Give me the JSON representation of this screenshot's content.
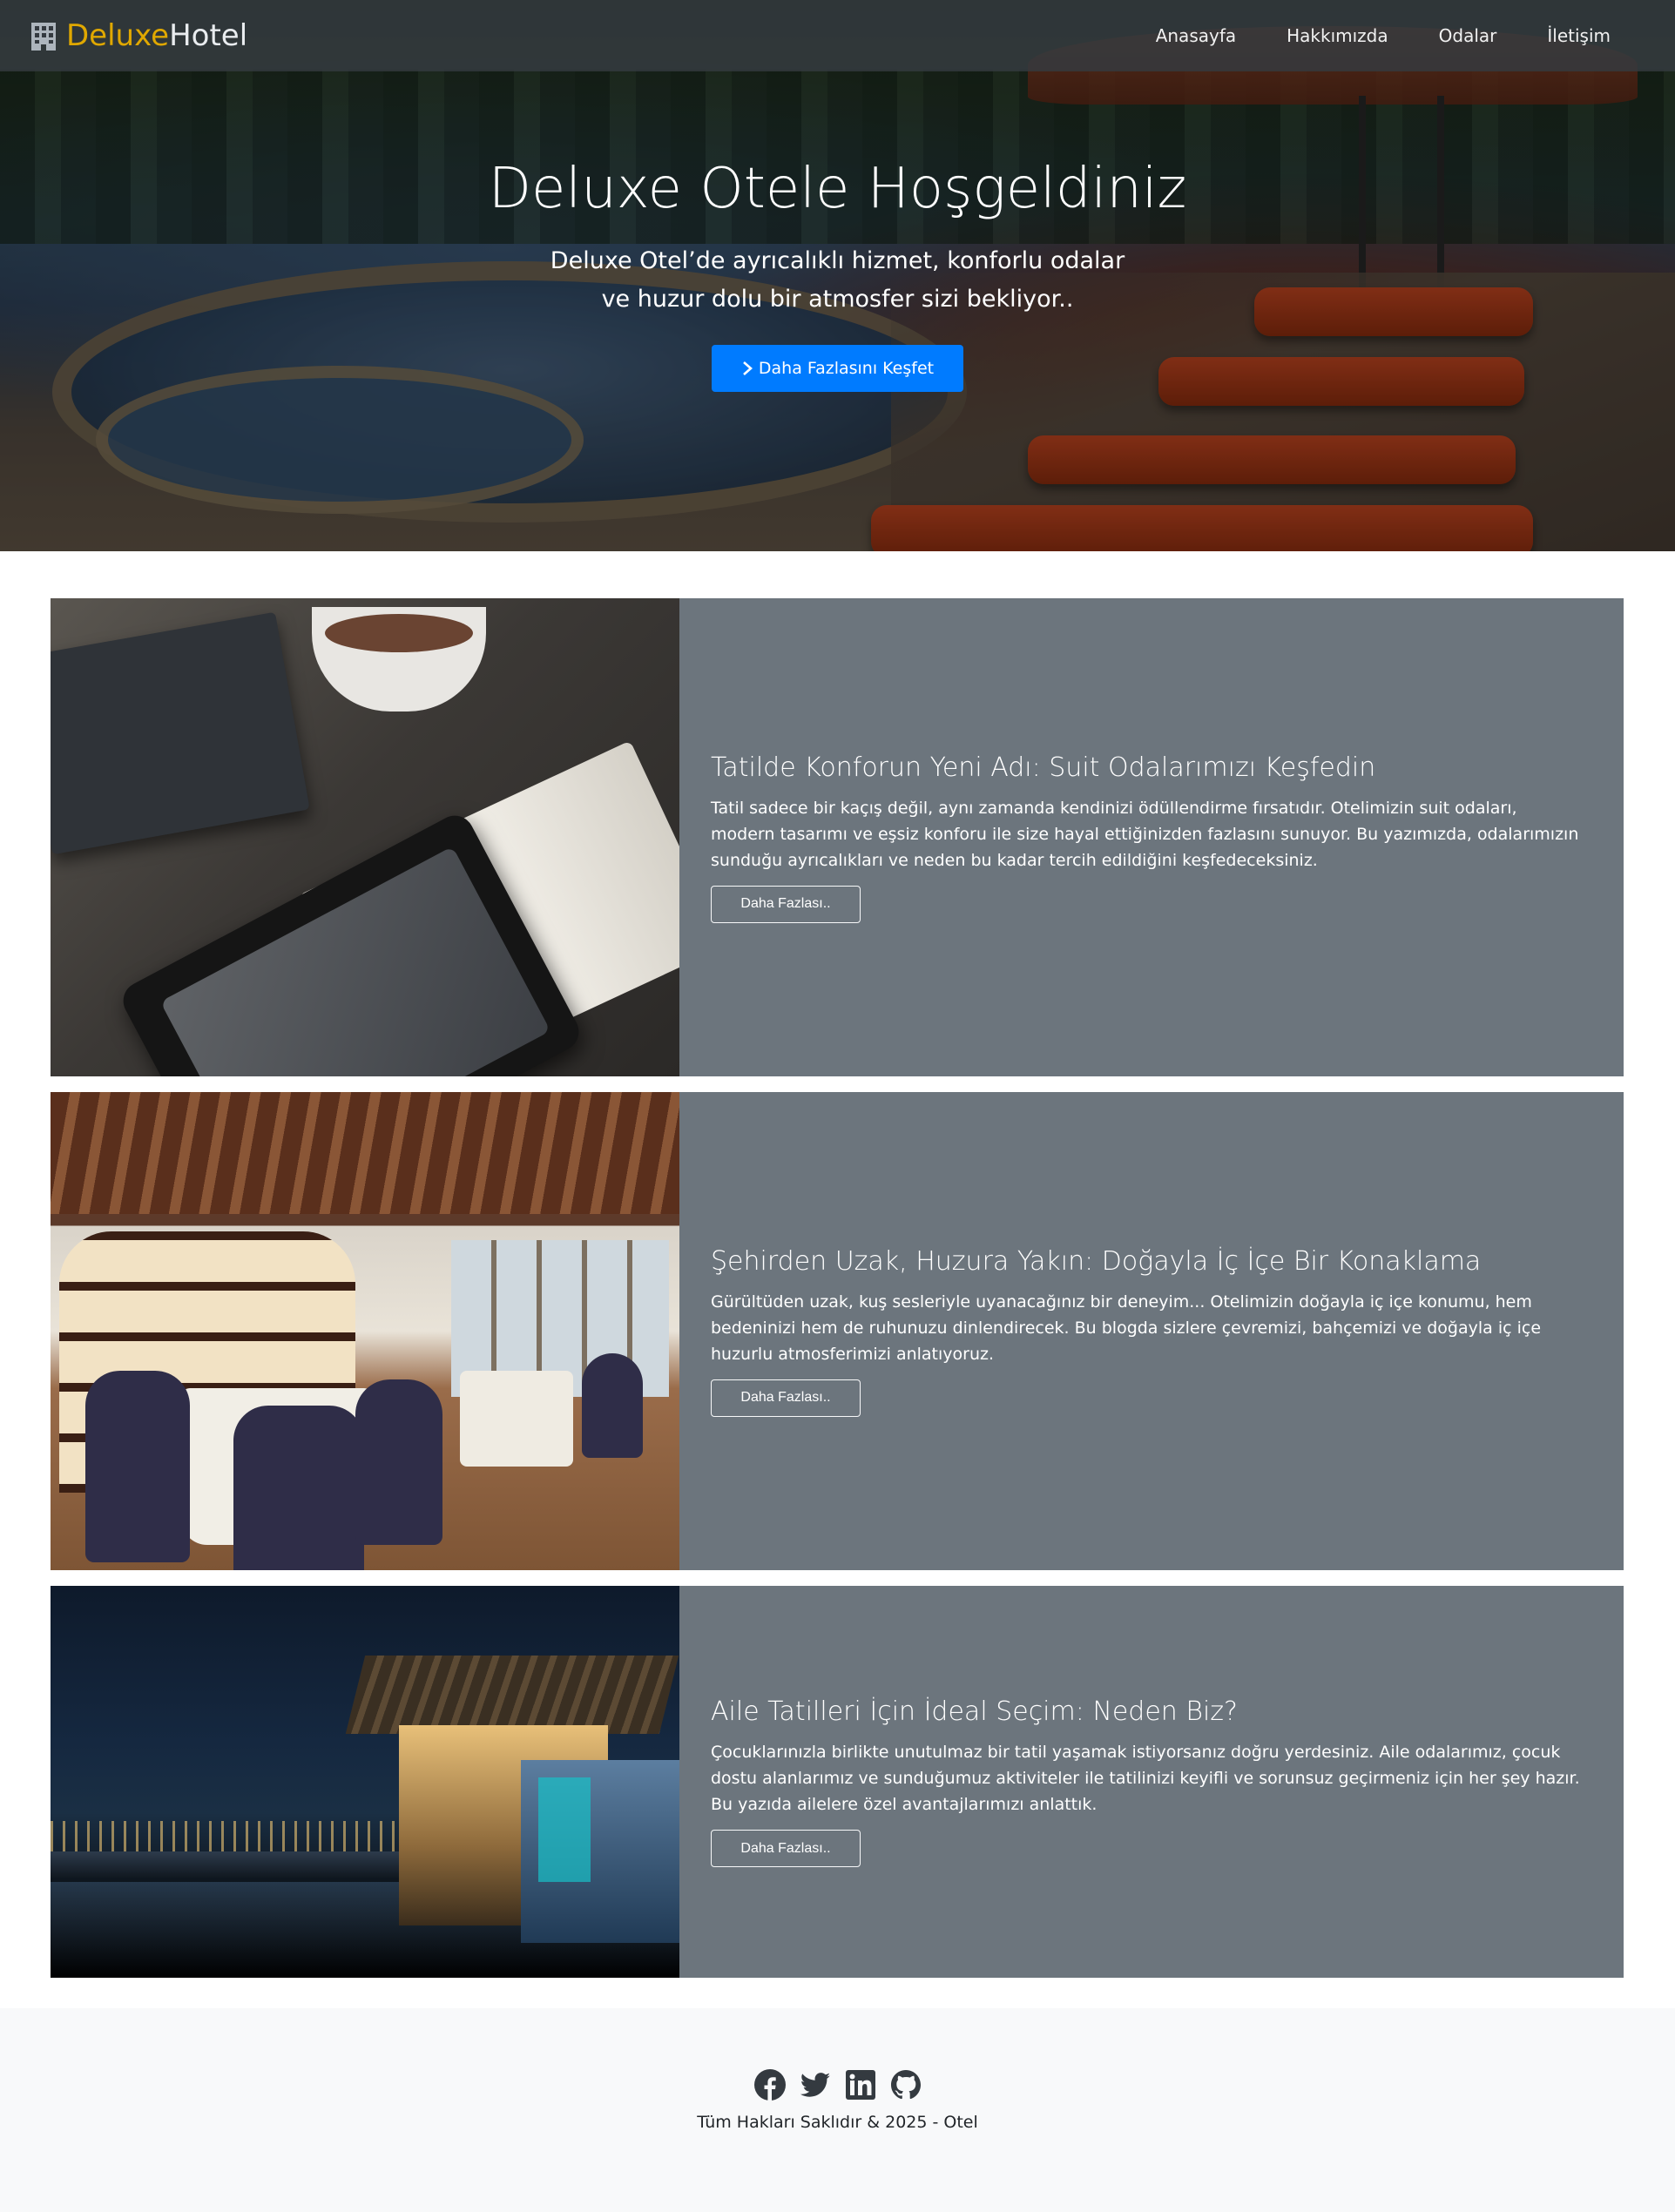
{
  "navbar": {
    "brand_part1": "Deluxe",
    "brand_part2": "Hotel",
    "brand_icon": "building-icon",
    "links": [
      "Anasayfa",
      "Hakkımızda",
      "Odalar",
      "İletişim"
    ]
  },
  "hero": {
    "title": "Deluxe Otele Hoşgeldiniz",
    "subtitle": "Deluxe Otel’de ayrıcalıklı hizmet, konforlu odalar ve huzur dolu bir atmosfer sizi bekliyor..",
    "button_label": "Daha Fazlasını Keşfet",
    "button_icon": "chevron-right-icon",
    "button_color": "#007bff"
  },
  "cards": [
    {
      "title": "Tatilde Konforun Yeni Adı: Suit Odalarımızı Keşfedin",
      "text": "Tatil sadece bir kaçış değil, aynı zamanda kendinizi ödüllendirme fırsatıdır. Otelimizin suit odaları, modern tasarımı ve eşsiz konforu ile size hayal ettiğinizden fazlasını sunuyor. Bu yazımızda, odalarımızın sunduğu ayrıcalıkları ve neden bu kadar tercih edildiğini keşfedeceksiniz.",
      "button_label": "Daha Fazlası.."
    },
    {
      "title": "Şehirden Uzak, Huzura Yakın: Doğayla İç İçe Bir Konaklama",
      "text": "Gürültüden uzak, kuş sesleriyle uyanacağınız bir deneyim... Otelimizin doğayla iç içe konumu, hem bedeninizi hem de ruhunuzu dinlendirecek. Bu blogda sizlere çevremizi, bahçemizi ve doğayla iç içe huzurlu atmosferimizi anlatıyoruz.",
      "button_label": "Daha Fazlası.."
    },
    {
      "title": "Aile Tatilleri İçin İdeal Seçim: Neden Biz?",
      "text": "Çocuklarınızla birlikte unutulmaz bir tatil yaşamak istiyorsanız doğru yerdesiniz. Aile odalarımız, çocuk dostu alanlarımız ve sunduğumuz aktiviteler ile tatilinizi keyifli ve sorunsuz geçirmeniz için her şey hazır. Bu yazıda ailelere özel avantajlarımızı anlattık.",
      "button_label": "Daha Fazlası.."
    }
  ],
  "footer": {
    "social_icons": [
      "facebook-icon",
      "twitter-icon",
      "linkedin-icon",
      "github-icon"
    ],
    "copyright": "Tüm Hakları Saklıdır & 2025 - Otel"
  },
  "colors": {
    "brand_accent": "#e0a800",
    "card_background": "#6c757d",
    "footer_background": "#f8f9fa"
  }
}
